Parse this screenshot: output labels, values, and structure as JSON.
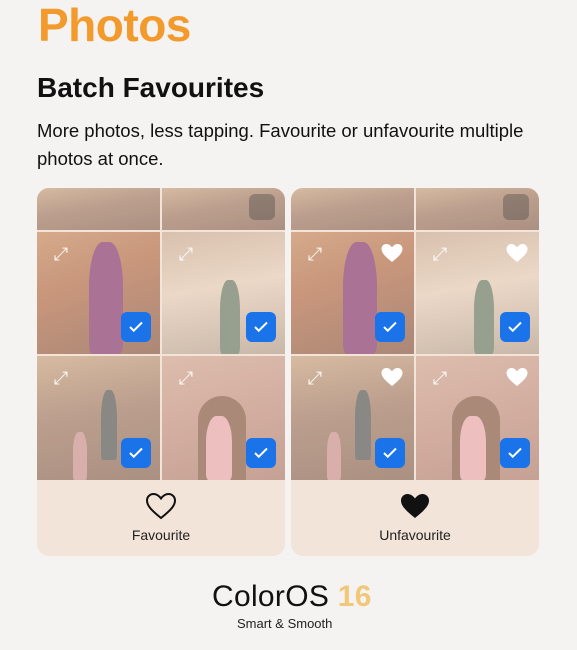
{
  "header": {
    "title": "Photos",
    "subtitle": "Batch Favourites",
    "description": "More photos, less tapping. Favourite or unfavourite multiple photos at once."
  },
  "panels": [
    {
      "action_label": "Favourite",
      "action_icon": "heart-outline-icon",
      "favourited": false
    },
    {
      "action_label": "Unfavourite",
      "action_icon": "heart-filled-icon",
      "favourited": true
    }
  ],
  "footer": {
    "brand_name": "ColorOS",
    "brand_version": "16",
    "tagline": "Smart & Smooth"
  },
  "colors": {
    "title_orange": "#f39a2c",
    "check_blue": "#1a73e8",
    "version_gold": "#f2c77a"
  }
}
